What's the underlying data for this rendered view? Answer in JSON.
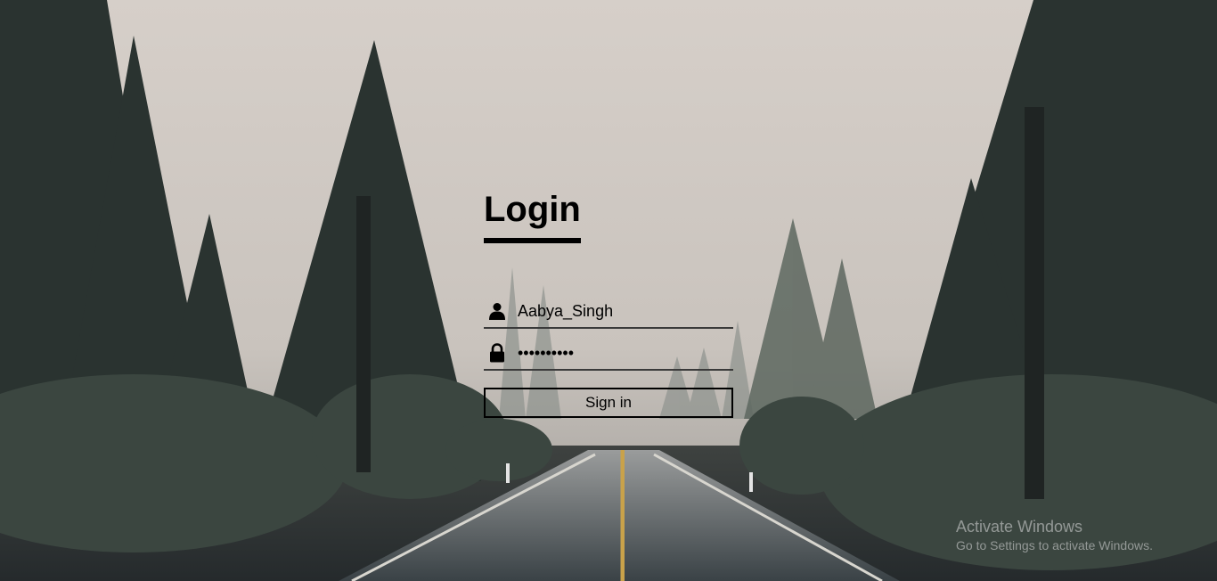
{
  "login": {
    "title": "Login",
    "username_value": "Aabya_Singh",
    "password_value": "••••••••••",
    "signin_label": "Sign in",
    "username_icon": "user-icon",
    "password_icon": "lock-icon"
  },
  "watermark": {
    "title": "Activate Windows",
    "subtitle": "Go to Settings to activate Windows."
  },
  "background": {
    "description_icon": "forest-road-background"
  }
}
